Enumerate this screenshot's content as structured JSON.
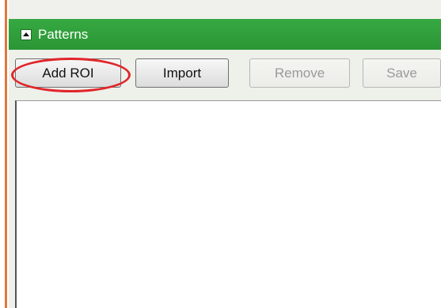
{
  "panel": {
    "title": "Patterns"
  },
  "toolbar": {
    "add_roi_label": "Add ROI",
    "import_label": "Import",
    "remove_label": "Remove",
    "save_label": "Save"
  },
  "colors": {
    "titlebar": "#2f9f3a",
    "accent_left": "#e2773b",
    "highlight": "#e0262a"
  }
}
